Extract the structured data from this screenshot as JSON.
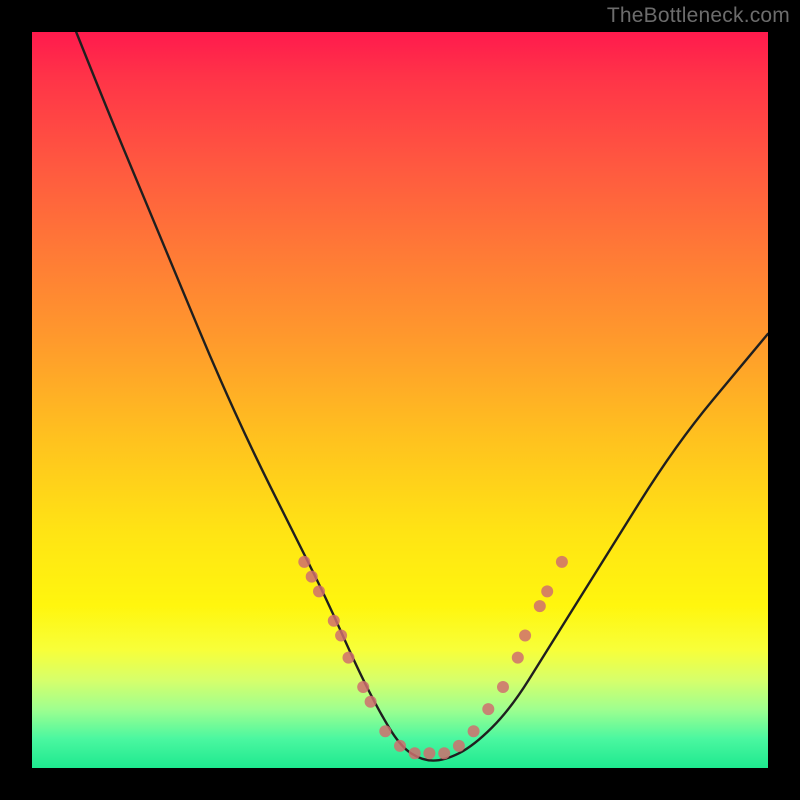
{
  "watermark": "TheBottleneck.com",
  "colors": {
    "frame": "#000000",
    "curve_stroke": "#1f1f1f",
    "marker_fill": "#cf6e6e",
    "gradient_stops": [
      {
        "pos": 0.0,
        "hex": "#ff1a4d"
      },
      {
        "pos": 0.06,
        "hex": "#ff3348"
      },
      {
        "pos": 0.18,
        "hex": "#ff5840"
      },
      {
        "pos": 0.3,
        "hex": "#ff7a36"
      },
      {
        "pos": 0.42,
        "hex": "#ff9a2c"
      },
      {
        "pos": 0.55,
        "hex": "#ffc11f"
      },
      {
        "pos": 0.68,
        "hex": "#ffe414"
      },
      {
        "pos": 0.78,
        "hex": "#fff60e"
      },
      {
        "pos": 0.84,
        "hex": "#f7ff3a"
      },
      {
        "pos": 0.88,
        "hex": "#d7ff6a"
      },
      {
        "pos": 0.92,
        "hex": "#9fff8f"
      },
      {
        "pos": 0.96,
        "hex": "#4bf7a0"
      },
      {
        "pos": 1.0,
        "hex": "#1ee98f"
      }
    ]
  },
  "chart_data": {
    "type": "line",
    "title": "",
    "xlabel": "",
    "ylabel": "",
    "xlim": [
      0,
      100
    ],
    "ylim": [
      0,
      100
    ],
    "series": [
      {
        "name": "bottleneck-curve",
        "x": [
          6,
          10,
          15,
          20,
          25,
          30,
          35,
          40,
          44,
          47,
          50,
          53,
          56,
          60,
          65,
          70,
          75,
          80,
          85,
          90,
          95,
          100
        ],
        "y": [
          100,
          90,
          78,
          66,
          54,
          43,
          33,
          23,
          14,
          8,
          3,
          1,
          1,
          3,
          8,
          16,
          24,
          32,
          40,
          47,
          53,
          59
        ]
      }
    ],
    "markers": [
      {
        "name": "left-cluster",
        "points": [
          [
            37,
            28
          ],
          [
            38,
            26
          ],
          [
            39,
            24
          ],
          [
            41,
            20
          ],
          [
            42,
            18
          ],
          [
            43,
            15
          ],
          [
            45,
            11
          ],
          [
            46,
            9
          ]
        ]
      },
      {
        "name": "valley-cluster",
        "points": [
          [
            48,
            5
          ],
          [
            50,
            3
          ],
          [
            52,
            2
          ],
          [
            54,
            2
          ],
          [
            56,
            2
          ],
          [
            58,
            3
          ]
        ]
      },
      {
        "name": "right-cluster",
        "points": [
          [
            60,
            5
          ],
          [
            62,
            8
          ],
          [
            64,
            11
          ],
          [
            66,
            15
          ],
          [
            67,
            18
          ],
          [
            69,
            22
          ],
          [
            70,
            24
          ],
          [
            72,
            28
          ]
        ]
      }
    ]
  }
}
